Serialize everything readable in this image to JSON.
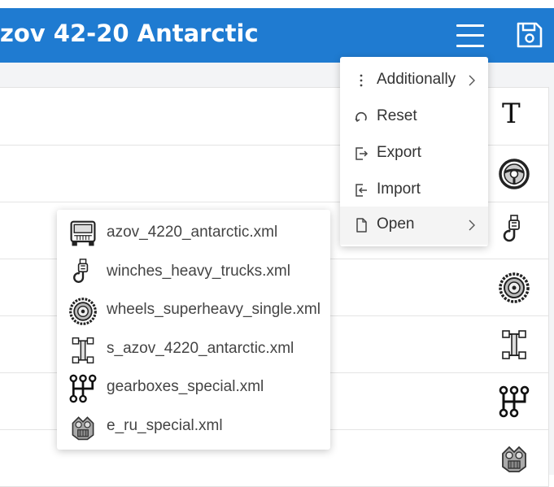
{
  "header": {
    "title": "zov 42-20 Antarctic"
  },
  "toolbar": {
    "menu_icon": "hamburger-icon",
    "save_icon": "save-icon"
  },
  "side_rows": [
    {
      "icon": "text-icon",
      "glyph": "T"
    },
    {
      "icon": "steering-wheel-icon"
    },
    {
      "icon": "winch-hook-icon"
    },
    {
      "icon": "wheel-icon"
    },
    {
      "icon": "chassis-icon"
    },
    {
      "icon": "gearbox-icon"
    },
    {
      "icon": "engine-icon"
    }
  ],
  "menu": {
    "items": [
      {
        "label": "Additionally",
        "icon": "vertical-dots-icon",
        "has_submenu": true
      },
      {
        "label": "Reset",
        "icon": "reset-icon"
      },
      {
        "label": "Export",
        "icon": "export-icon"
      },
      {
        "label": "Import",
        "icon": "import-icon"
      },
      {
        "label": "Open",
        "icon": "file-icon",
        "has_submenu": true,
        "active": true
      }
    ]
  },
  "open_submenu": {
    "files": [
      {
        "label": "azov_4220_antarctic.xml",
        "icon": "truck-icon"
      },
      {
        "label": "winches_heavy_trucks.xml",
        "icon": "winch-hook-icon"
      },
      {
        "label": "wheels_superheavy_single.xml",
        "icon": "wheel-icon"
      },
      {
        "label": "s_azov_4220_antarctic.xml",
        "icon": "chassis-icon"
      },
      {
        "label": "gearboxes_special.xml",
        "icon": "gearbox-icon"
      },
      {
        "label": "e_ru_special.xml",
        "icon": "engine-icon"
      }
    ]
  }
}
